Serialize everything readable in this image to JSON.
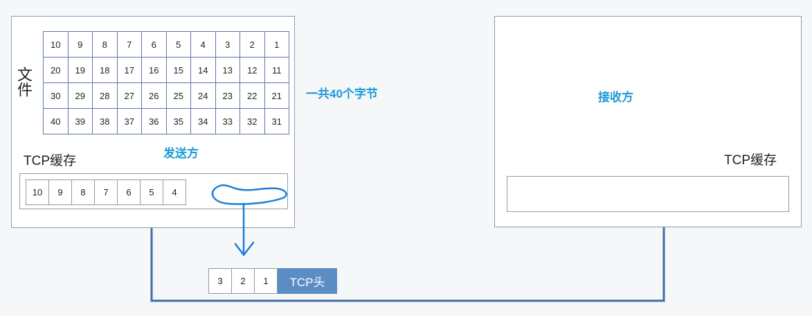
{
  "sender": {
    "file_label": "文件",
    "grid_rows": [
      [
        "10",
        "9",
        "8",
        "7",
        "6",
        "5",
        "4",
        "3",
        "2",
        "1"
      ],
      [
        "20",
        "19",
        "18",
        "17",
        "16",
        "15",
        "14",
        "13",
        "12",
        "11"
      ],
      [
        "30",
        "29",
        "28",
        "27",
        "26",
        "25",
        "24",
        "23",
        "22",
        "21"
      ],
      [
        "40",
        "39",
        "38",
        "37",
        "36",
        "35",
        "34",
        "33",
        "32",
        "31"
      ]
    ],
    "total_note": "一共40个字节",
    "title": "发送方",
    "tcp_cache_label": "TCP缓存",
    "buffer_cells": [
      "10",
      "9",
      "8",
      "7",
      "6",
      "5",
      "4"
    ]
  },
  "receiver": {
    "title": "接收方",
    "tcp_cache_label": "TCP缓存"
  },
  "segment": {
    "cells": [
      "3",
      "2",
      "1"
    ],
    "header_label": "TCP头"
  },
  "colors": {
    "accent_blue": "#1a9ad6",
    "grid_line": "#5a79a3",
    "link_line": "#3f6da6",
    "header_fill": "#5b8cc4",
    "annotation": "#1b7fd6"
  }
}
